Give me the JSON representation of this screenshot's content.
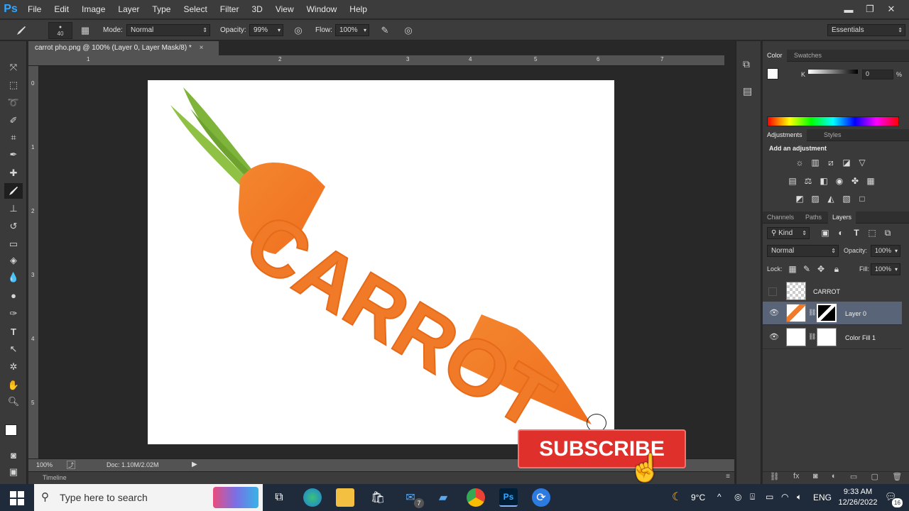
{
  "app": {
    "logo": "Ps"
  },
  "menu": [
    "File",
    "Edit",
    "Image",
    "Layer",
    "Type",
    "Select",
    "Filter",
    "3D",
    "View",
    "Window",
    "Help"
  ],
  "window_controls": {
    "minimize": "▬",
    "restore": "❐",
    "close": "✕"
  },
  "options": {
    "brush_size": "40",
    "mode_label": "Mode:",
    "mode_value": "Normal",
    "opacity_label": "Opacity:",
    "opacity_value": "99%",
    "flow_label": "Flow:",
    "flow_value": "100%",
    "workspace": "Essentials"
  },
  "document": {
    "tab_title": "carrot pho.png @ 100% (Layer 0, Layer Mask/8) *",
    "tab_close": "×",
    "ruler_h": [
      "1",
      "2",
      "3",
      "4",
      "5",
      "6",
      "7"
    ],
    "ruler_v": [
      "0",
      "1",
      "2",
      "3",
      "4",
      "5"
    ],
    "zoom": "100%",
    "doc_info": "Doc: 1.10M/2.02M",
    "carrot_text": "CARROT"
  },
  "timeline_label": "Timeline",
  "panels": {
    "color_tabs": [
      "Color",
      "Swatches"
    ],
    "color_channel": "K",
    "color_value": "0",
    "color_unit": "%",
    "adjust_tabs": [
      "Adjustments",
      "Styles"
    ],
    "adjust_heading": "Add an adjustment",
    "layers_tabs": [
      "Channels",
      "Paths",
      "Layers"
    ],
    "kind_label": "Kind",
    "blend_mode": "Normal",
    "opacity_label": "Opacity:",
    "opacity_value": "100%",
    "lock_label": "Lock:",
    "fill_label": "Fill:",
    "fill_value": "100%",
    "layers": [
      {
        "name": "CARROT"
      },
      {
        "name": "Layer 0"
      },
      {
        "name": "Color Fill 1"
      }
    ]
  },
  "overlay": {
    "subscribe": "SUBSCRIBE"
  },
  "taskbar": {
    "search_placeholder": "Type here to search",
    "mail_badge": "7",
    "weather": "9°C",
    "language": "ENG",
    "time": "9:33 AM",
    "date": "12/26/2022",
    "notification_count": "16"
  },
  "colors": {
    "carrot_orange": "#f07a28",
    "carrot_green": "#7fb43a",
    "subscribe_red": "#e0302c",
    "ps_blue": "#31a8ff"
  }
}
